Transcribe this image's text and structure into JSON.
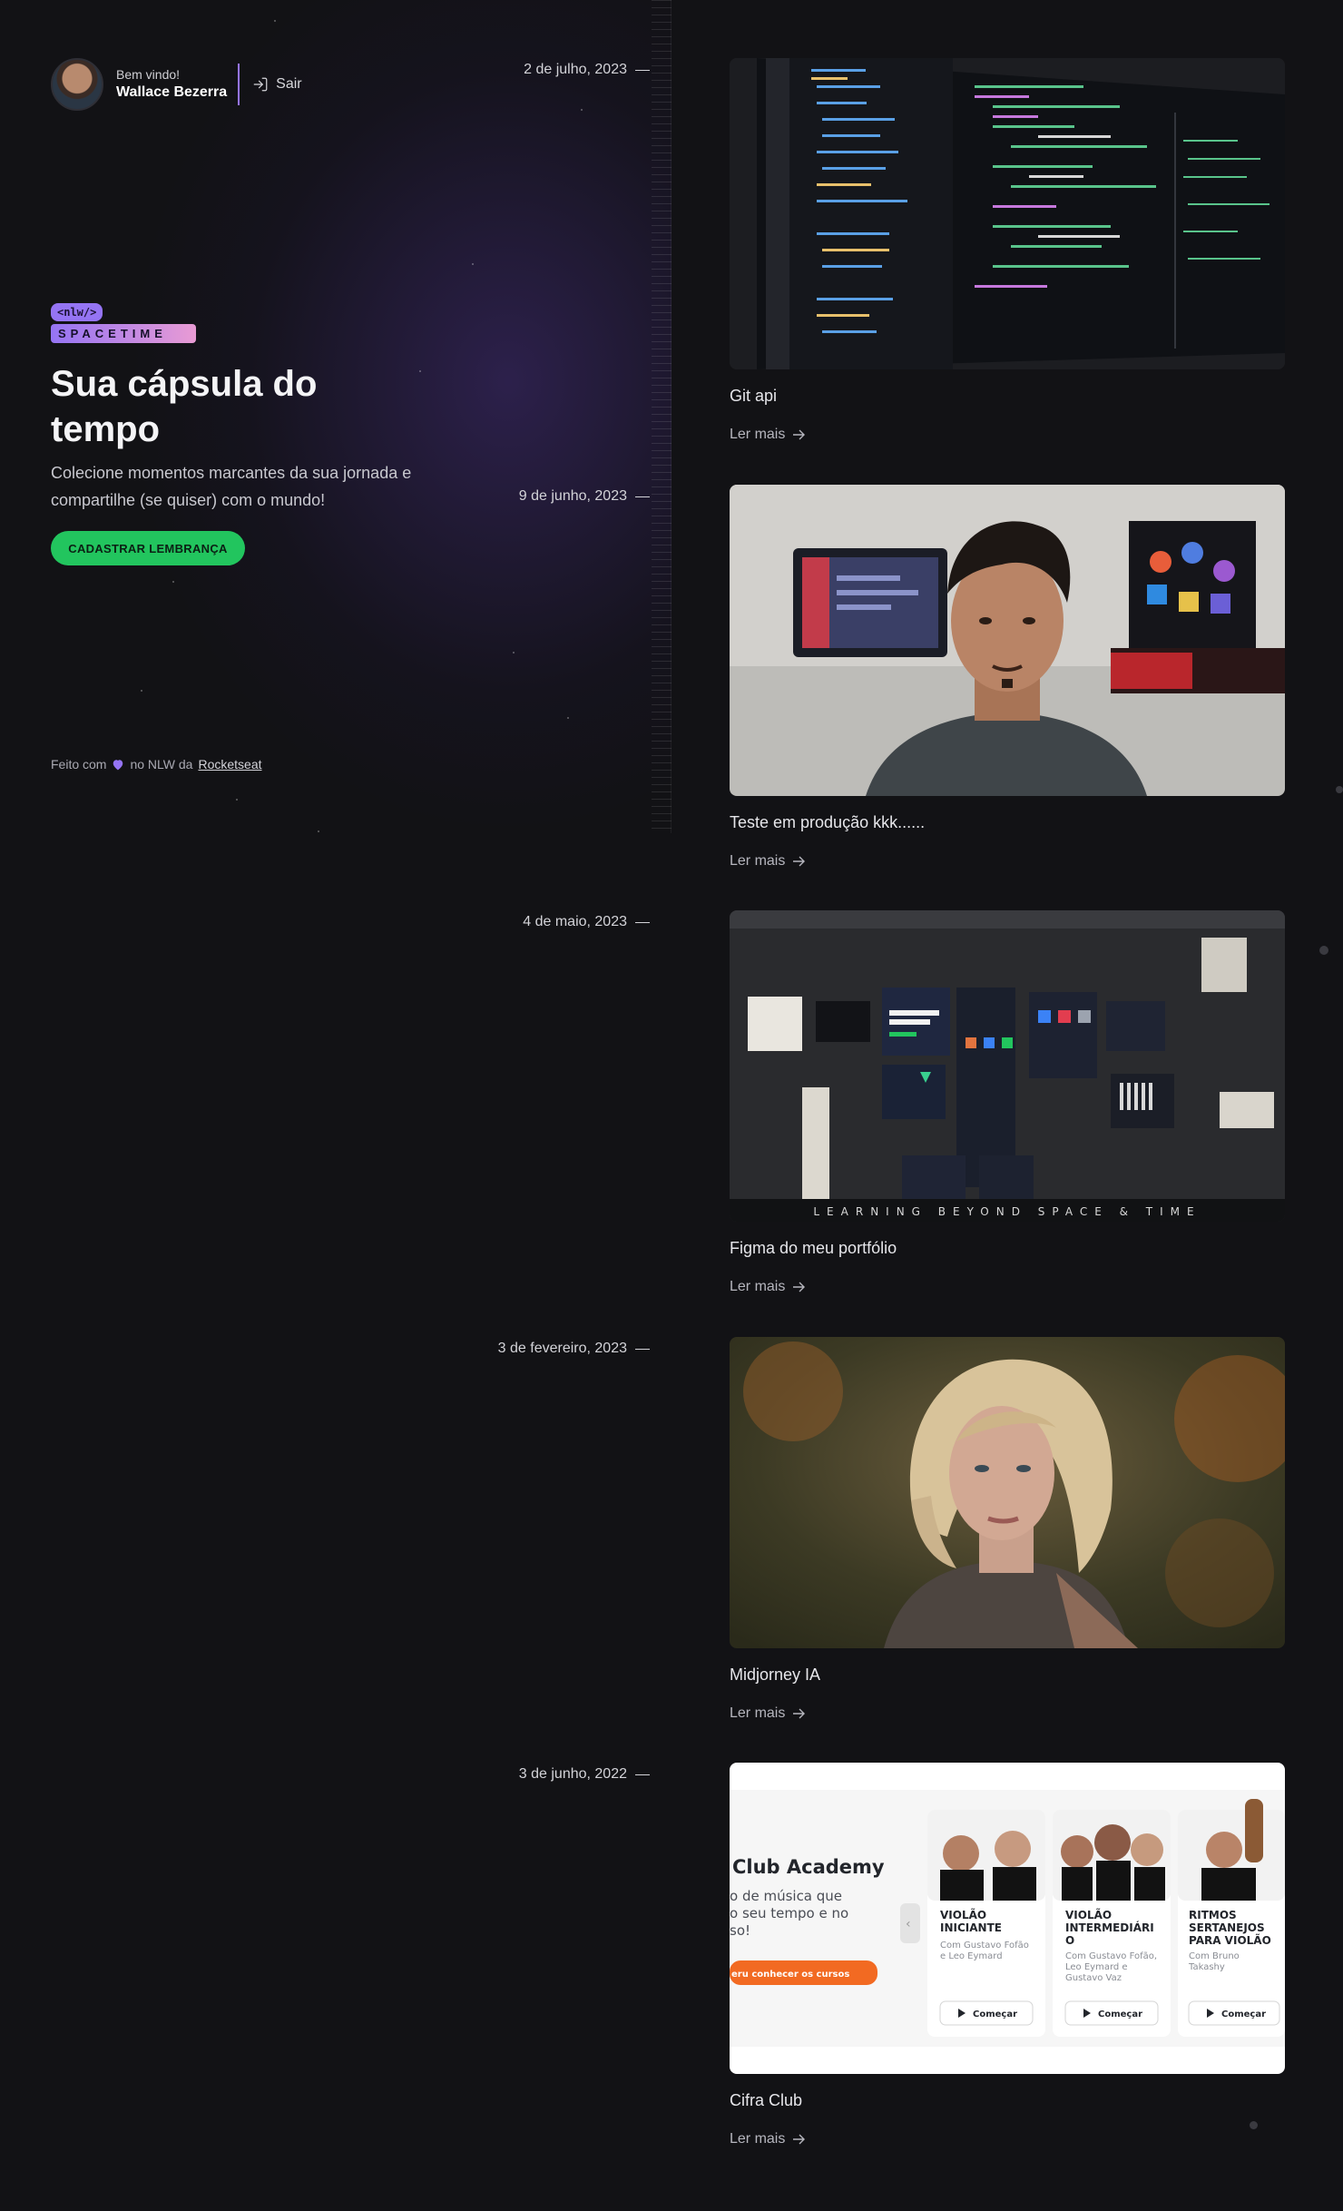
{
  "profile": {
    "welcome": "Bem vindo!",
    "name": "Wallace Bezerra",
    "logout_label": "Sair"
  },
  "brand": {
    "nlw_badge": "<nlw/>",
    "spacetime_badge": "SPACETIME"
  },
  "hero": {
    "title": "Sua cápsula do tempo",
    "subtitle": "Colecione momentos marcantes da sua jornada e compartilhe (se quiser) com o mundo!",
    "cta_label": "CADASTRAR LEMBRANÇA"
  },
  "footer": {
    "prefix": "Feito com",
    "middle": "no NLW da",
    "link": "Rocketseat"
  },
  "colors": {
    "accent_purple": "#9574f4",
    "cta_green": "#22c55e",
    "background": "#121215"
  },
  "memories": [
    {
      "date": "2 de julho, 2023",
      "title": "Git api",
      "read_more": "Ler mais",
      "image_icon": "code-editor-photo"
    },
    {
      "date": "9 de junho, 2023",
      "title": "Teste em produção kkk......",
      "read_more": "Ler mais",
      "image_icon": "selfie-photo"
    },
    {
      "date": "4 de maio, 2023",
      "title": "Figma do meu portfólio",
      "read_more": "Ler mais",
      "image_icon": "figma-board-photo",
      "image_caption": "LEARNING BEYOND SPACE & TIME"
    },
    {
      "date": "3 de fevereiro, 2023",
      "title": "Midjorney IA",
      "read_more": "Ler mais",
      "image_icon": "portrait-photo"
    },
    {
      "date": "3 de junho, 2022",
      "title": "Cifra Club",
      "read_more": "Ler mais",
      "image_icon": "website-screenshot",
      "site": {
        "heading": "Club Academy",
        "tagline_1": "o de música que",
        "tagline_2": "o seu tempo e no",
        "tagline_3": "so!",
        "cta": "eru conhecer os cursos",
        "courses": [
          {
            "title_1": "VIOLÃO",
            "title_2": "INICIANTE",
            "title_3": "",
            "author_1": "Com Gustavo Fofão",
            "author_2": "e Leo Eymard",
            "author_3": "",
            "button": "Começar"
          },
          {
            "title_1": "VIOLÃO",
            "title_2": "INTERMEDIÁRI",
            "title_3": "O",
            "author_1": "Com Gustavo Fofão,",
            "author_2": "Leo Eymard e",
            "author_3": "Gustavo Vaz",
            "button": "Começar"
          },
          {
            "title_1": "RITMOS",
            "title_2": "SERTANEJOS",
            "title_3": "PARA VIOLÃO",
            "author_1": "Com Bruno",
            "author_2": "Takashy",
            "author_3": "",
            "button": "Começar"
          }
        ]
      }
    }
  ]
}
